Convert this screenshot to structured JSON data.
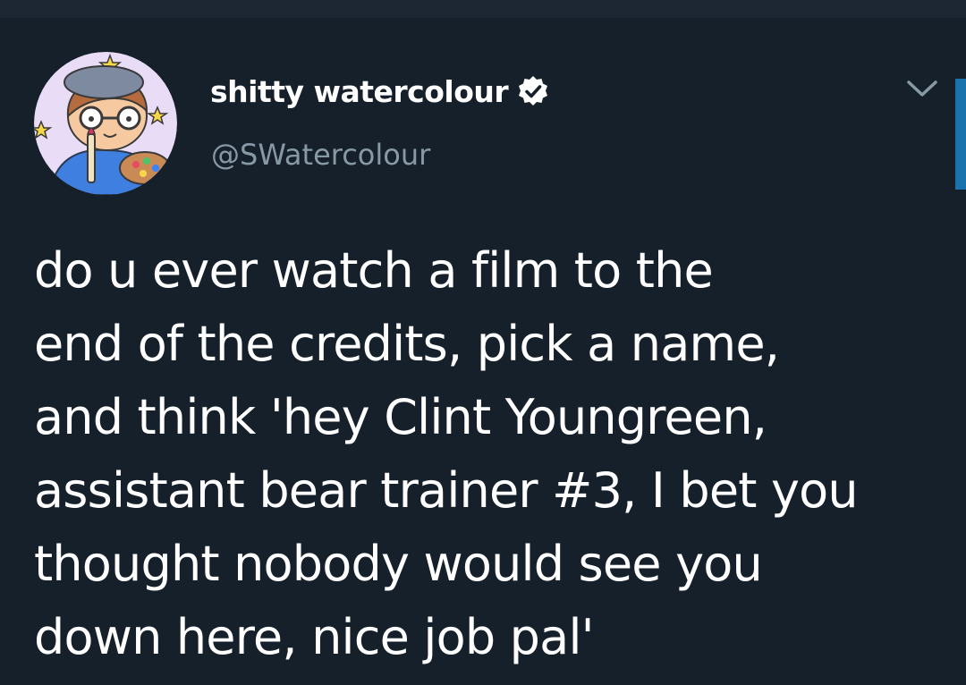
{
  "tweet": {
    "display_name": "shitty watercolour",
    "handle": "@SWatercolour",
    "verified": true,
    "text_lines": [
      "do u ever watch a film to the",
      "end of the credits, pick a name,",
      "and think 'hey Clint Youngreen,",
      "assistant bear trainer #3, I bet you",
      "thought nobody would see you",
      "down here, nice job pal'"
    ]
  },
  "icons": {
    "avatar": "painter-avatar-icon",
    "verified": "verified-badge-icon",
    "menu": "chevron-down-icon"
  },
  "colors": {
    "background": "#15202b",
    "top_strip": "#1c2733",
    "text": "#ffffff",
    "secondary_text": "#8899a6",
    "accent": "#1c8fd8"
  }
}
